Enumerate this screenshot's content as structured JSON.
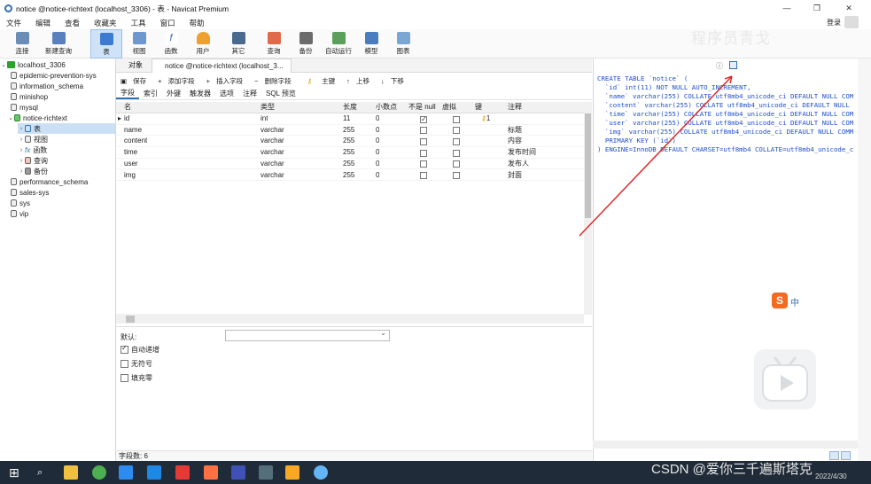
{
  "window": {
    "title": "notice @notice-richtext (localhost_3306) - 表 - Navicat Premium",
    "min": "—",
    "max": "❐",
    "close": "✕"
  },
  "menu": [
    "文件",
    "编辑",
    "查看",
    "收藏夹",
    "工具",
    "窗口",
    "帮助"
  ],
  "login": "登录",
  "toolbar": [
    {
      "label": "连接",
      "icon": "connection-icon"
    },
    {
      "label": "新建查询",
      "icon": "new-query-icon"
    },
    {
      "label": "表",
      "icon": "table-icon"
    },
    {
      "label": "视图",
      "icon": "view-icon"
    },
    {
      "label": "函数",
      "icon": "function-icon"
    },
    {
      "label": "用户",
      "icon": "user-icon"
    },
    {
      "label": "其它",
      "icon": "other-icon"
    },
    {
      "label": "查询",
      "icon": "query-icon"
    },
    {
      "label": "备份",
      "icon": "backup-icon"
    },
    {
      "label": "自动运行",
      "icon": "autorun-icon"
    },
    {
      "label": "模型",
      "icon": "model-icon"
    },
    {
      "label": "图表",
      "icon": "chart-icon"
    }
  ],
  "watermark": "程序员青戈",
  "sidebar": {
    "connection": "localhost_3306",
    "databases": [
      "epidemic-prevention-sys",
      "information_schema",
      "minishop",
      "mysql",
      "notice-richtext"
    ],
    "children": [
      "表",
      "视图",
      "函数",
      "查询",
      "备份"
    ],
    "databases_after": [
      "performance_schema",
      "sales-sys",
      "sys",
      "vip"
    ]
  },
  "tabs": {
    "objects": "对象",
    "editor": "notice @notice-richtext (localhost_3..."
  },
  "actions": [
    "保存",
    "添加字段",
    "插入字段",
    "删除字段",
    "主键",
    "上移",
    "下移"
  ],
  "subtabs": [
    "字段",
    "索引",
    "外键",
    "触发器",
    "选项",
    "注释",
    "SQL 预览"
  ],
  "grid": {
    "headers": [
      "名",
      "类型",
      "长度",
      "小数点",
      "不是 null",
      "虚拟",
      "键",
      "注释"
    ],
    "rows": [
      {
        "name": "id",
        "type": "int",
        "len": "11",
        "dec": "0",
        "notnull": true,
        "virtual": false,
        "key": "1",
        "comment": ""
      },
      {
        "name": "name",
        "type": "varchar",
        "len": "255",
        "dec": "0",
        "notnull": false,
        "virtual": false,
        "key": "",
        "comment": "标题"
      },
      {
        "name": "content",
        "type": "varchar",
        "len": "255",
        "dec": "0",
        "notnull": false,
        "virtual": false,
        "key": "",
        "comment": "内容"
      },
      {
        "name": "time",
        "type": "varchar",
        "len": "255",
        "dec": "0",
        "notnull": false,
        "virtual": false,
        "key": "",
        "comment": "发布时间"
      },
      {
        "name": "user",
        "type": "varchar",
        "len": "255",
        "dec": "0",
        "notnull": false,
        "virtual": false,
        "key": "",
        "comment": "发布人"
      },
      {
        "name": "img",
        "type": "varchar",
        "len": "255",
        "dec": "0",
        "notnull": false,
        "virtual": false,
        "key": "",
        "comment": "封面"
      }
    ]
  },
  "props": {
    "default_label": "默认:",
    "auto_increment": "自动递增",
    "unsigned": "无符号",
    "zerofill": "填充零"
  },
  "status": "字段数: 6",
  "ddl": [
    "CREATE TABLE `notice` (",
    "  `id` int(11) NOT NULL AUTO_INCREMENT,",
    "  `name` varchar(255) COLLATE utf8mb4_unicode_ci DEFAULT NULL COM",
    "  `content` varchar(255) COLLATE utf8mb4_unicode_ci DEFAULT NULL",
    "  `time` varchar(255) COLLATE utf8mb4_unicode_ci DEFAULT NULL COM",
    "  `user` varchar(255) COLLATE utf8mb4_unicode_ci DEFAULT NULL COM",
    "  `img` varchar(255) COLLATE utf8mb4_unicode_ci DEFAULT NULL COMM",
    "  PRIMARY KEY (`id`)",
    ") ENGINE=InnoDB DEFAULT CHARSET=utf8mb4 COLLATE=utf8mb4_unicode_c"
  ],
  "ime": "中",
  "csdn": "CSDN @爱你三千遍斯塔克",
  "date": "2022/4/30",
  "colors": {
    "accent": "#2f6fb3",
    "taskbar": "#1f2b38",
    "arrow": "#e02020"
  }
}
